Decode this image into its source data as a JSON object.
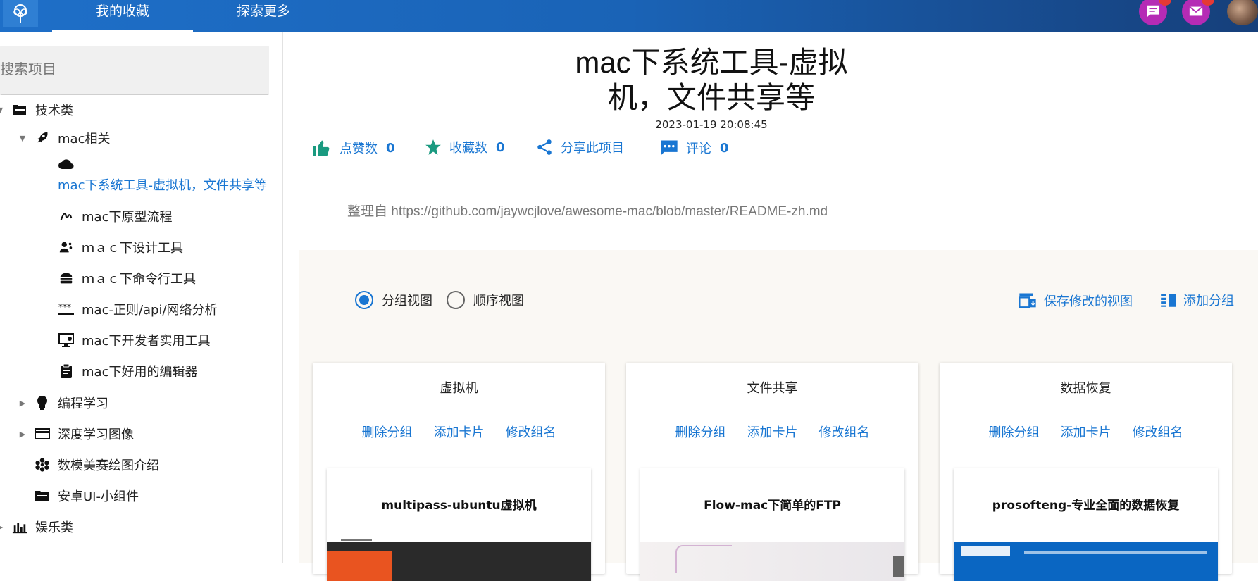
{
  "nav": {
    "tabs": [
      {
        "label": "我的收藏",
        "active": true
      },
      {
        "label": "探索更多",
        "active": false
      }
    ],
    "icons": {
      "logo": "tree-icon",
      "messages": "chat-icon",
      "mail": "mail-icon"
    },
    "badge_color": "#e53935",
    "accent": "#1976d2"
  },
  "sidebar": {
    "search_placeholder": "搜索项目",
    "tree": [
      {
        "label": "技术类",
        "icon": "folder-open-icon",
        "expanded": true
      },
      {
        "label": "mac相关",
        "icon": "rocket-icon",
        "expanded": true
      },
      {
        "label": "mac下系统工具-虚拟机，文件共享等",
        "icon": "cloud-icon",
        "selected": true
      },
      {
        "label": "mac下原型流程",
        "icon": "gesture-icon"
      },
      {
        "label": "ｍａｃ下设计工具",
        "icon": "people-icon"
      },
      {
        "label": "ｍａｃ下命令行工具",
        "icon": "fastfood-icon"
      },
      {
        "label": "mac-正则/api/网络分析",
        "icon": "password-icon"
      },
      {
        "label": "mac下开发者实用工具",
        "icon": "monitor-icon"
      },
      {
        "label": "mac下好用的编辑器",
        "icon": "clipboard-icon"
      },
      {
        "label": "编程学习",
        "icon": "lightbulb-icon",
        "expanded": false
      },
      {
        "label": "深度学习图像",
        "icon": "card-icon",
        "expanded": false
      },
      {
        "label": "数模美赛绘图介绍",
        "icon": "flower-icon"
      },
      {
        "label": "安卓UI-小组件",
        "icon": "folder-icon"
      },
      {
        "label": "娱乐类",
        "icon": "chart-icon"
      }
    ]
  },
  "article": {
    "title_line1": "mac下系统工具-虚拟",
    "title_line2": "机，文件共享等",
    "date": "2023-01-19 20:08:45",
    "actions": {
      "likes_label": "点赞数",
      "likes_count": "0",
      "favorites_label": "收藏数",
      "favorites_count": "0",
      "share_label": "分享此项目",
      "comments_label": "评论",
      "comments_count": "0"
    },
    "source_prefix": "整理自",
    "source_url": "https://github.com/jaywcjlove/awesome-mac/blob/master/README-zh.md"
  },
  "board": {
    "view_grouped": "分组视图",
    "view_sequential": "顺序视图",
    "selected_view": "grouped",
    "save_view": "保存修改的视图",
    "add_group": "添加分组",
    "group_actions": {
      "delete": "删除分组",
      "add_card": "添加卡片",
      "rename": "修改组名"
    },
    "groups": [
      {
        "title": "虚拟机",
        "card_title": "multipass-ubuntu虚拟机"
      },
      {
        "title": "文件共享",
        "card_title": "Flow-mac下简单的FTP"
      },
      {
        "title": "数据恢复",
        "card_title": "prosofteng-专业全面的数据恢复"
      }
    ]
  }
}
